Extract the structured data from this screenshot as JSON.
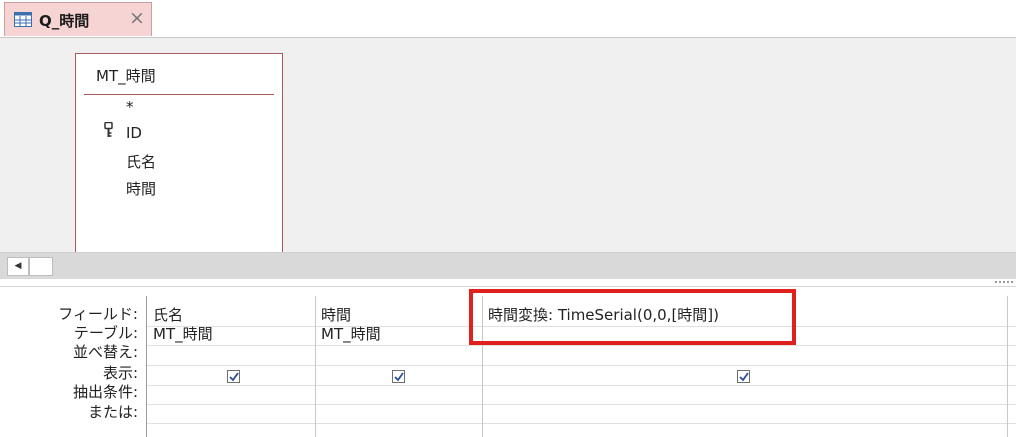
{
  "tab": {
    "title": "Q_時間",
    "icon": "query-icon",
    "close_label": "×"
  },
  "table": {
    "name": "MT_時間",
    "fields": [
      "*",
      "ID",
      "氏名",
      "時間"
    ],
    "primary_key": "ID"
  },
  "grid": {
    "row_labels": {
      "field": "フィールド:",
      "table": "テーブル:",
      "sort": "並べ替え:",
      "show": "表示:",
      "criteria": "抽出条件:",
      "or": "または:"
    },
    "columns": [
      {
        "field": "氏名",
        "table": "MT_時間",
        "show": true
      },
      {
        "field": "時間",
        "table": "MT_時間",
        "show": true
      },
      {
        "field": "時間変換: TimeSerial(0,0,[時間])",
        "table": "",
        "show": true
      }
    ]
  },
  "colors": {
    "tab_bg": "#f7d4d4",
    "table_border": "#a35b5b",
    "highlight": "#e0201c"
  }
}
